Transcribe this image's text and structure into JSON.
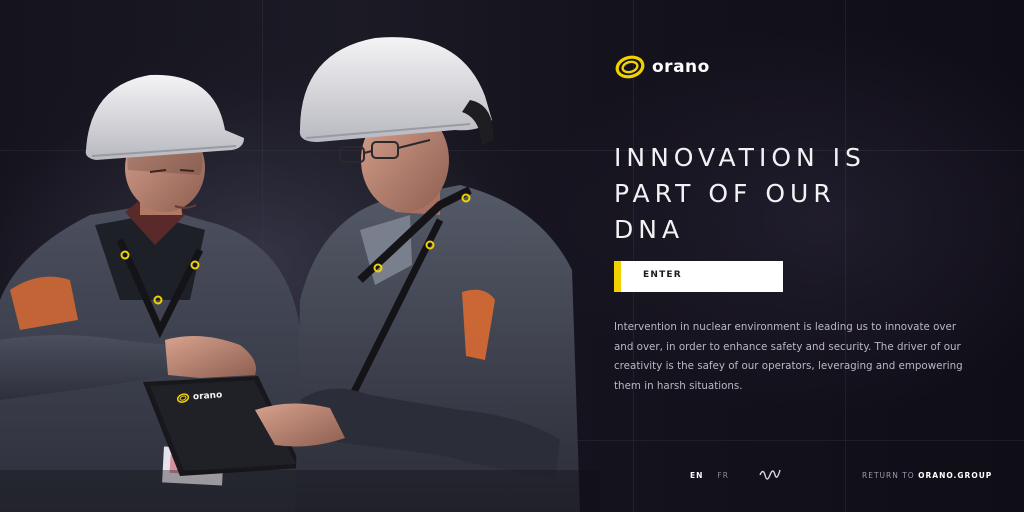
{
  "brand": {
    "logo_text": "orano",
    "accent_color": "#f1d200"
  },
  "hero": {
    "headline_lines": [
      "INNOVATION IS",
      "PART OF OUR",
      "DNA"
    ],
    "enter_label": "ENTER",
    "description": "Intervention in nuclear environment is leading us to innovate over and over, in order to enhance safety and security. The driver of our creativity is the safey of our operators, leveraging and empowering them in harsh situations.",
    "tablet_logo_text": "orano"
  },
  "footer": {
    "lang_en": "EN",
    "lang_fr": "FR",
    "return_prefix": "RETURN TO ",
    "return_site": "ORANO.GROUP"
  },
  "icons": {
    "logo": "orano-ring-logo-icon",
    "wave": "wave-signal-icon"
  }
}
